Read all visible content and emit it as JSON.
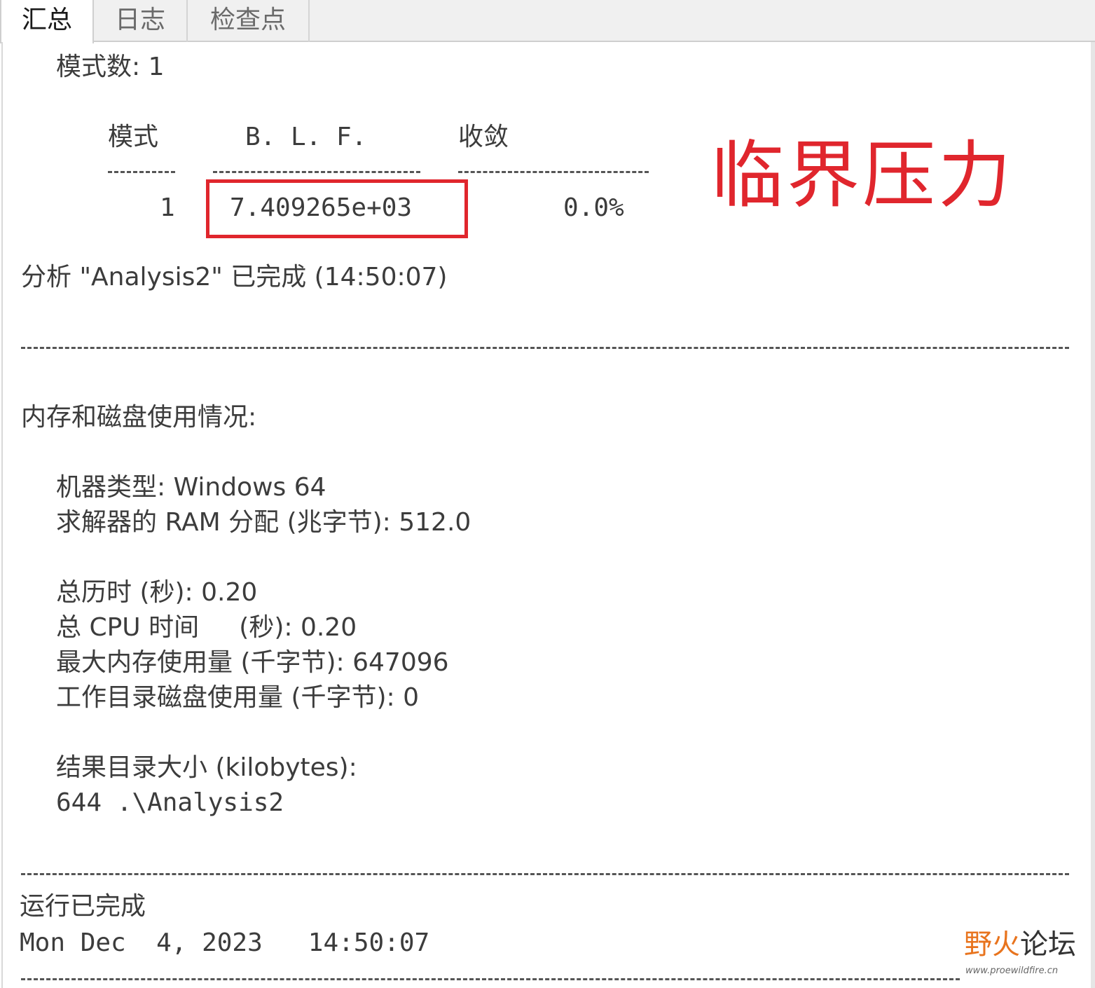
{
  "tabs": [
    {
      "label": "汇总",
      "active": true
    },
    {
      "label": "日志",
      "active": false
    },
    {
      "label": "检查点",
      "active": false
    }
  ],
  "summary": {
    "mode_count_line": "模式数: 1",
    "table": {
      "headers": [
        "模式",
        "B. L. F.",
        "收敛"
      ],
      "rows": [
        {
          "mode": "1",
          "blf": "7.409265e+03",
          "convergence": "0.0%"
        }
      ]
    },
    "analysis_done": "分析 \"Analysis2\" 已完成 (14:50:07)"
  },
  "usage": {
    "heading": "内存和磁盘使用情况:",
    "machine_type": "机器类型: Windows 64",
    "solver_ram": "求解器的 RAM 分配 (兆字节): 512.0",
    "total_elapsed": "总历时 (秒): 0.20",
    "total_cpu": "总 CPU 时间     (秒): 0.20",
    "max_memory": "最大内存使用量 (千字节): 647096",
    "workdir_disk": "工作目录磁盘使用量 (千字节): 0",
    "results_heading": "结果目录大小 (kilobytes):",
    "results_entry": "644 .\\Analysis2"
  },
  "run": {
    "status": "运行已完成",
    "timestamp": "Mon Dec  4, 2023   14:50:07"
  },
  "annotation": {
    "text": "临界压力",
    "color": "#e0262d"
  },
  "watermark": {
    "main_a": "野火",
    "main_b": "论坛",
    "url": "www.proewildfire.cn"
  }
}
